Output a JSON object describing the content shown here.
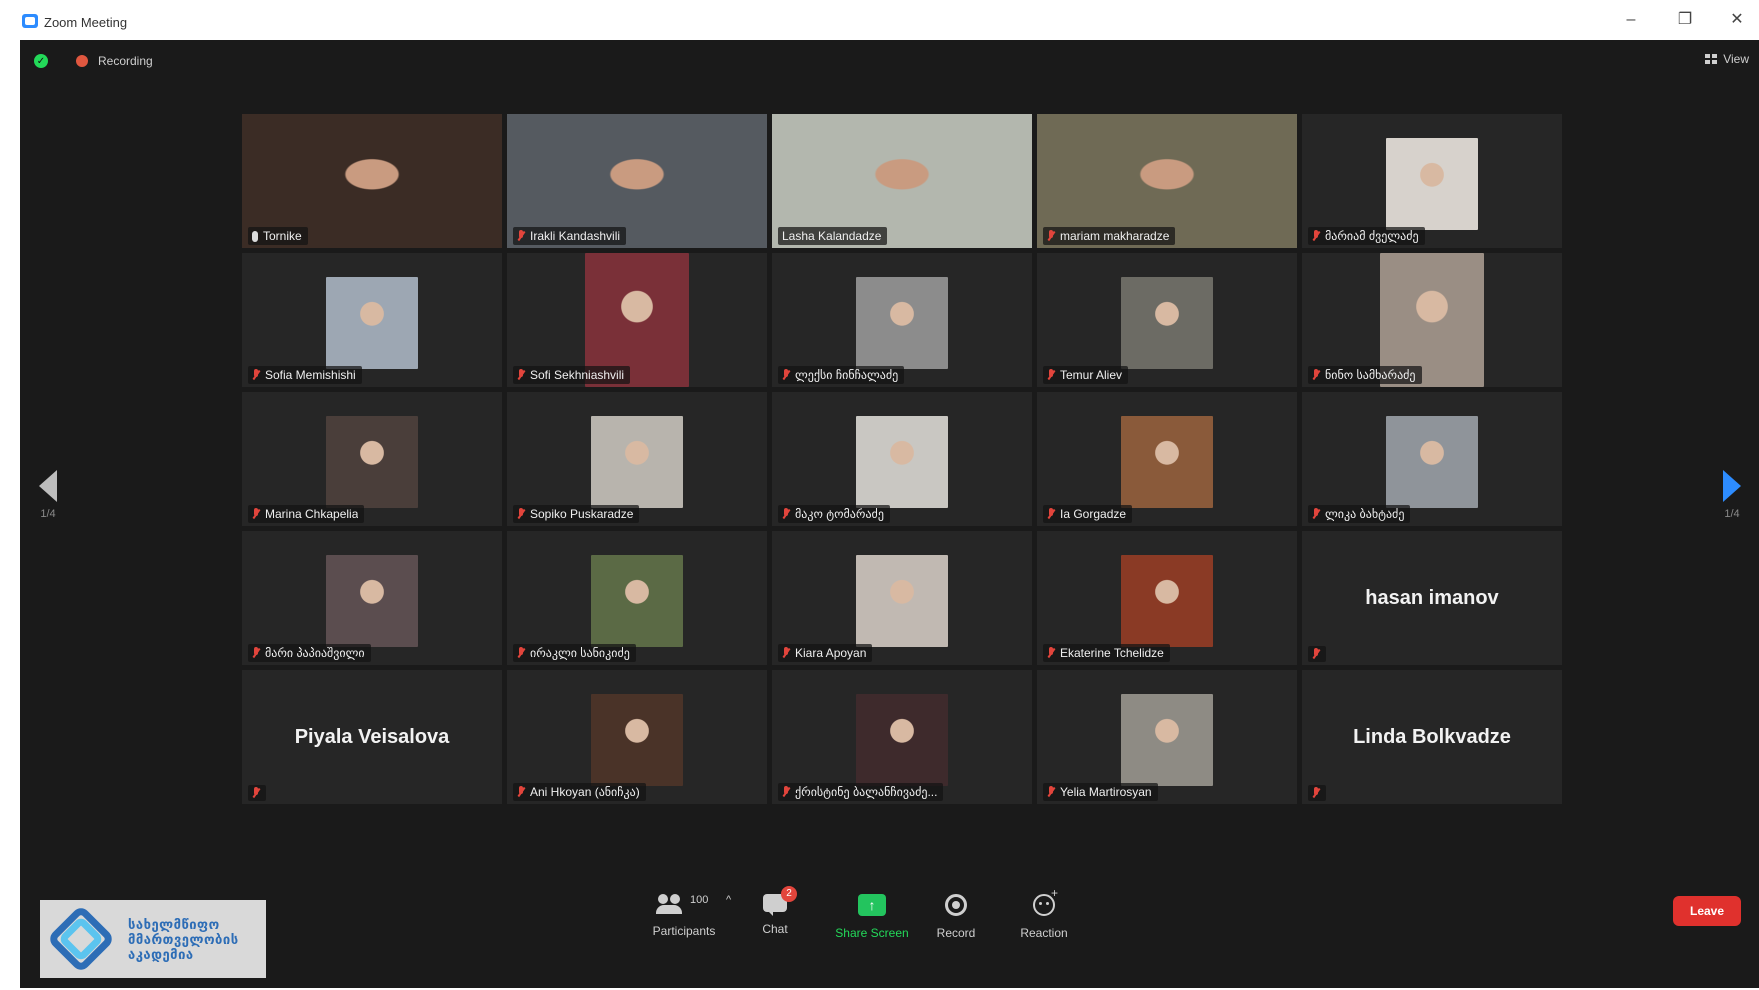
{
  "window": {
    "title": "Zoom Meeting",
    "minimize": "–",
    "restore": "❐",
    "close": "✕"
  },
  "status": {
    "recording_label": "Recording",
    "view_label": "View"
  },
  "pager": {
    "left_page": "1/4",
    "right_page": "1/4"
  },
  "tiles": [
    {
      "name": "Tornike",
      "type": "video",
      "mic": "on",
      "bg": "#3b2c25"
    },
    {
      "name": "Irakli Kandashvili",
      "type": "video",
      "mic": "muted",
      "bg": "#555a60"
    },
    {
      "name": "Lasha Kalandadze",
      "type": "video",
      "mic": "none",
      "bg": "#b3b7ae",
      "active": true
    },
    {
      "name": "mariam makharadze",
      "type": "video",
      "mic": "muted",
      "bg": "#6f6a55"
    },
    {
      "name": "მარიამ ძველაძე",
      "type": "photo",
      "mic": "muted",
      "bg": "#d7d2cc"
    },
    {
      "name": "Sofia Memishishi",
      "type": "photo",
      "mic": "muted",
      "bg": "#9da7b3"
    },
    {
      "name": "Sofi Sekhniashvili",
      "type": "photo-tall",
      "mic": "muted",
      "bg": "#7a3038"
    },
    {
      "name": "ლექსი ჩინჩალაძე",
      "type": "photo",
      "mic": "muted",
      "bg": "#8c8c8c"
    },
    {
      "name": "Temur Aliev",
      "type": "photo",
      "mic": "muted",
      "bg": "#6c6b64"
    },
    {
      "name": "ნინო სამხარაძე",
      "type": "photo-tall",
      "mic": "muted",
      "bg": "#9a8e84"
    },
    {
      "name": "Marina Chkapelia",
      "type": "photo",
      "mic": "muted",
      "bg": "#4a3e3a"
    },
    {
      "name": "Sopiko Puskaradze",
      "type": "photo",
      "mic": "muted",
      "bg": "#b8b4ad"
    },
    {
      "name": "მაკო ტომარაძე",
      "type": "photo",
      "mic": "muted",
      "bg": "#c9c7c2"
    },
    {
      "name": "Ia Gorgadze",
      "type": "photo",
      "mic": "muted",
      "bg": "#8a5a3a"
    },
    {
      "name": "ლიკა ბახტაძე",
      "type": "photo",
      "mic": "muted",
      "bg": "#8f949a"
    },
    {
      "name": "მარი პაპიაშვილი",
      "type": "photo",
      "mic": "muted",
      "bg": "#5b4d4f"
    },
    {
      "name": "ირაკლი სანიკიძე",
      "type": "photo",
      "mic": "muted",
      "bg": "#5b6a45"
    },
    {
      "name": "Kiara Apoyan",
      "type": "photo",
      "mic": "muted",
      "bg": "#c1b9b2"
    },
    {
      "name": "Ekaterine Tchelidze",
      "type": "photo",
      "mic": "muted",
      "bg": "#8a3a25"
    },
    {
      "name": "hasan imanov",
      "type": "name",
      "mic": "muted"
    },
    {
      "name": "Piyala Veisalova",
      "type": "name",
      "mic": "muted"
    },
    {
      "name": "Ani Hkoyan (ანიჩკა)",
      "type": "photo",
      "mic": "muted",
      "bg": "#4a3328"
    },
    {
      "name": "ქრისტინე ბალანჩივაძე...",
      "type": "photo",
      "mic": "muted",
      "bg": "#3e2a2c"
    },
    {
      "name": "Yelia Martirosyan",
      "type": "photo",
      "mic": "muted",
      "bg": "#8e8b84"
    },
    {
      "name": "Linda Bolkvadze",
      "type": "name",
      "mic": "muted"
    }
  ],
  "toolbar": {
    "participants_label": "Participants",
    "participants_count": "100",
    "participants_caret": "^",
    "chat_label": "Chat",
    "chat_badge": "2",
    "share_label": "Share Screen",
    "share_arrow": "↑",
    "record_label": "Record",
    "reactions_label": "Reaction",
    "leave_label": "Leave"
  },
  "logo": {
    "line1": "სახელმწიფო",
    "line2": "მმართველობის",
    "line3": "აკადემია"
  },
  "colors": {
    "accent": "#2d8cff",
    "share_green": "#23c45e",
    "leave_red": "#e0312d",
    "active_speaker": "#d6e86b"
  }
}
